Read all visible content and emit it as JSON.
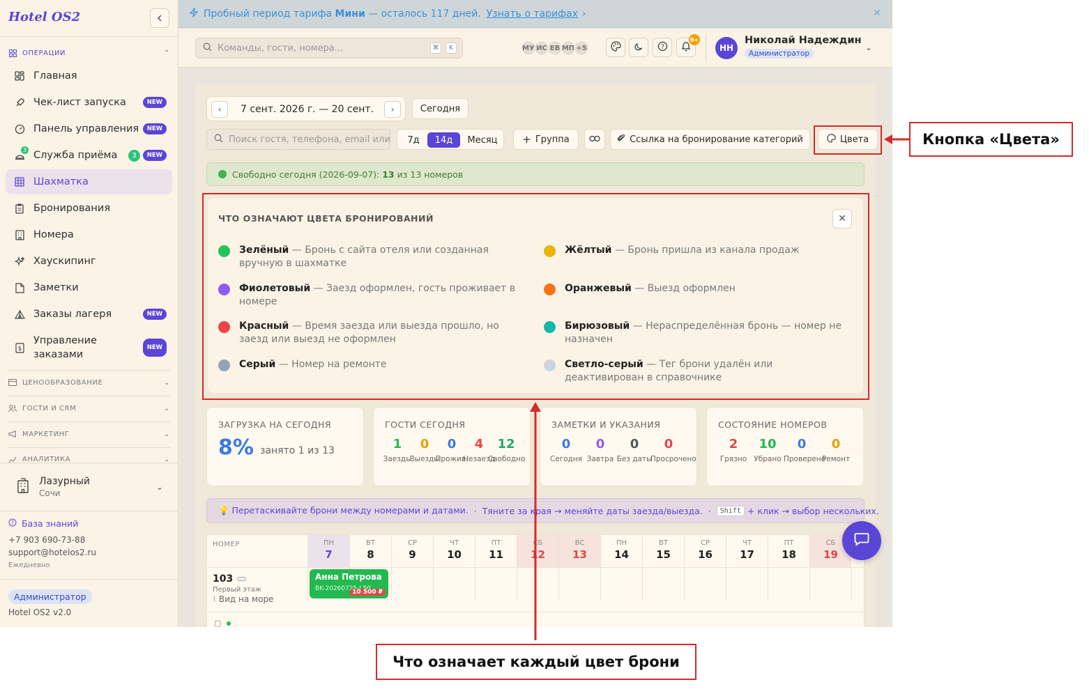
{
  "app": {
    "logo": "Hotel OS2"
  },
  "sidebar": {
    "sections": {
      "operations": "ОПЕРАЦИИ",
      "pricing": "ЦЕНООБРАЗОВАНИЕ",
      "guests": "ГОСТИ И CRM",
      "marketing": "МАРКЕТИНГ",
      "analytics": "АНАЛИТИКА"
    },
    "items": [
      {
        "label": "Главная"
      },
      {
        "label": "Чек-лист запуска",
        "badge": "NEW"
      },
      {
        "label": "Панель управления",
        "badge": "NEW"
      },
      {
        "label": "Служба приёма",
        "badge": "NEW",
        "count": "3"
      },
      {
        "label": "Шахматка"
      },
      {
        "label": "Бронирования"
      },
      {
        "label": "Номера"
      },
      {
        "label": "Хаускипинг"
      },
      {
        "label": "Заметки"
      },
      {
        "label": "Заказы лагеря",
        "badge": "NEW"
      },
      {
        "label_line1": "Управление",
        "label_line2": "заказами",
        "badge": "NEW"
      }
    ],
    "hotel": {
      "name": "Лазурный",
      "city": "Сочи"
    },
    "knowledge_base": "База знаний",
    "phone": "+7 903 690-73-88",
    "email": "support@hotelos2.ru",
    "schedule": "Ежедневно",
    "role": "Администратор",
    "version": "Hotel OS2 v2.0"
  },
  "banner": {
    "prefix": "Пробный период тарифа",
    "plan": "Мини",
    "suffix": "— осталось 117 дней.",
    "link": "Узнать о тарифах",
    "link_arrow": "›"
  },
  "topbar": {
    "search_placeholder": "Команды, гости, номера...",
    "kbd1": "⌘",
    "kbd2": "K",
    "avatars": [
      "МУ",
      "ИС",
      "ЕВ",
      "МП",
      "+5"
    ],
    "bell_badge": "9+",
    "user": {
      "initials": "НН",
      "name": "Николай Надеждин",
      "role": "Администратор"
    }
  },
  "toolbar": {
    "date_range": "7 сент. 2026 г. — 20 сент.",
    "today": "Сегодня",
    "guest_search_placeholder": "Поиск гостя, телефона, email или",
    "views": [
      "7д",
      "14д",
      "Месяц"
    ],
    "group": "Группа",
    "booking_link": "Ссылка на бронирование категорий",
    "colors": "Цвета"
  },
  "free_today": {
    "text": "Свободно сегодня (2026-09-07):",
    "count": "13",
    "tail": "из 13 номеров"
  },
  "legend": {
    "title": "ЧТО ОЗНАЧАЮТ ЦВЕТА БРОНИРОВАНИЙ",
    "items": [
      {
        "name": "Зелёный",
        "desc": "— Бронь с сайта отеля или созданная вручную в шахматке",
        "color": "#22c55e"
      },
      {
        "name": "Жёлтый",
        "desc": "— Бронь пришла из канала продаж",
        "color": "#eab308"
      },
      {
        "name": "Фиолетовый",
        "desc": "— Заезд оформлен, гость проживает в номере",
        "color": "#8b5cf6"
      },
      {
        "name": "Оранжевый",
        "desc": "— Выезд оформлен",
        "color": "#f97316"
      },
      {
        "name": "Красный",
        "desc": "— Время заезда или выезда прошло, но заезд или выезд не оформлен",
        "color": "#ef4444"
      },
      {
        "name": "Бирюзовый",
        "desc": "— Нераспределённая бронь — номер не назначен",
        "color": "#14b8a6"
      },
      {
        "name": "Серый",
        "desc": "— Номер на ремонте",
        "color": "#94a3b8"
      },
      {
        "name": "Светло-серый",
        "desc": "— Тег брони удалён или деактивирован в справочнике",
        "color": "#cbd5e1"
      }
    ]
  },
  "stats": {
    "load": {
      "title": "ЗАГРУЗКА НА СЕГОДНЯ",
      "value": "8%",
      "sub": "занято 1 из 13"
    },
    "guests": {
      "title": "ГОСТИ СЕГОДНЯ",
      "items": [
        {
          "n": "1",
          "l": "Заезды",
          "c": "#22b94f"
        },
        {
          "n": "0",
          "l": "Выезды",
          "c": "#e6a100"
        },
        {
          "n": "0",
          "l": "Прожив.",
          "c": "#3b7be0"
        },
        {
          "n": "4",
          "l": "Незаезд",
          "c": "#e04747"
        },
        {
          "n": "12",
          "l": "Свободно",
          "c": "#22a86b"
        }
      ]
    },
    "notes": {
      "title": "ЗАМЕТКИ И УКАЗАНИЯ",
      "items": [
        {
          "n": "0",
          "l": "Сегодня",
          "c": "#3b7be0"
        },
        {
          "n": "0",
          "l": "Завтра",
          "c": "#8b5cf6"
        },
        {
          "n": "0",
          "l": "Без даты",
          "c": "#555555"
        },
        {
          "n": "0",
          "l": "Просрочено",
          "c": "#e04747"
        }
      ]
    },
    "rooms": {
      "title": "СОСТОЯНИЕ НОМЕРОВ",
      "items": [
        {
          "n": "2",
          "l": "Грязно",
          "c": "#e04747"
        },
        {
          "n": "10",
          "l": "Убрано",
          "c": "#22b94f"
        },
        {
          "n": "0",
          "l": "Проверено",
          "c": "#3b7be0"
        },
        {
          "n": "0",
          "l": "Ремонт",
          "c": "#e6a100"
        }
      ]
    }
  },
  "tip": {
    "part1": "💡 Перетаскивайте брони между номерами и датами.",
    "sep": "·",
    "part2": "Тяните за края → меняйте даты заезда/выезда.",
    "key": "Shift",
    "part3": "+ клик → выбор нескольких."
  },
  "grid": {
    "room_header": "НОМЕР",
    "days": [
      {
        "dw": "ПН",
        "dn": "7"
      },
      {
        "dw": "ВТ",
        "dn": "8"
      },
      {
        "dw": "СР",
        "dn": "9"
      },
      {
        "dw": "ЧТ",
        "dn": "10"
      },
      {
        "dw": "ПТ",
        "dn": "11"
      },
      {
        "dw": "СБ",
        "dn": "12"
      },
      {
        "dw": "ВС",
        "dn": "13"
      },
      {
        "dw": "ПН",
        "dn": "14"
      },
      {
        "dw": "ВТ",
        "dn": "15"
      },
      {
        "dw": "СР",
        "dn": "16"
      },
      {
        "dw": "ЧТ",
        "dn": "17"
      },
      {
        "dw": "ПТ",
        "dn": "18"
      },
      {
        "dw": "СБ",
        "dn": "19"
      }
    ],
    "room": {
      "number": "103",
      "floor": "Первый этаж",
      "view": "Вид на море"
    },
    "booking": {
      "name": "Анна Петрова",
      "code": "BK-20260725-L50",
      "price": "10 500 ₽"
    }
  },
  "annotations": {
    "colors_button": "Кнопка «Цвета»",
    "legend": "Что означает каждый цвет брони"
  }
}
